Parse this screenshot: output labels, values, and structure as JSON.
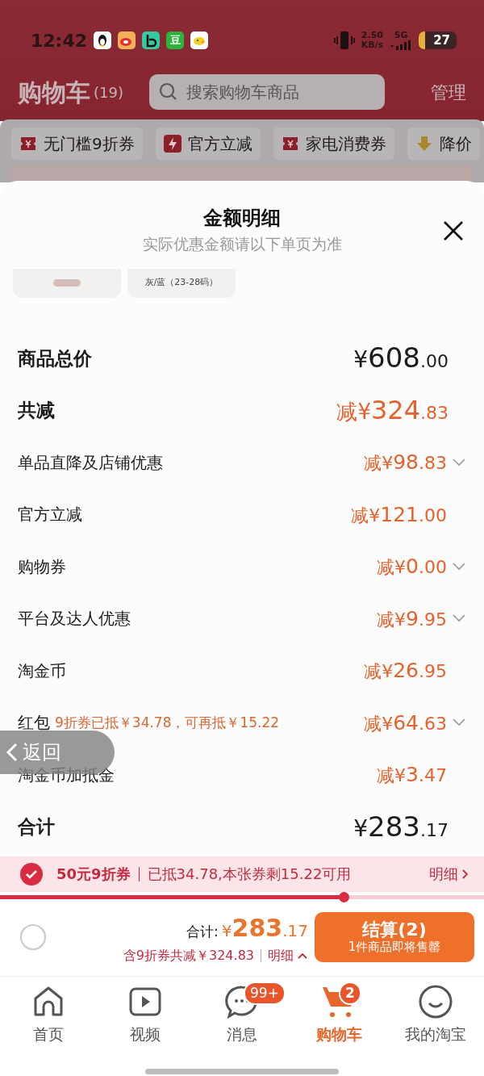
{
  "status_bar": {
    "time": "12:42",
    "app_icons": [
      {
        "kind": "penguin"
      },
      {
        "kind": "swirl"
      },
      {
        "kind": "letter-b"
      },
      {
        "kind": "text",
        "text": "豆"
      },
      {
        "kind": "chick"
      }
    ],
    "speed": "2.50",
    "speed_unit": "KB/s",
    "network": "5G",
    "battery": "27"
  },
  "header": {
    "title": "购物车",
    "count": "(19)",
    "search_placeholder": "搜索购物车商品",
    "manage": "管理"
  },
  "chips": [
    {
      "label": "无门槛9折券",
      "kind": "coupon"
    },
    {
      "label": "官方立减",
      "kind": "bolt"
    },
    {
      "label": "家电消费券",
      "kind": "coupon"
    },
    {
      "label": "降价",
      "kind": "arrow"
    }
  ],
  "sheet": {
    "title": "金额明细",
    "subtitle": "实际优惠金额请以下单页为准",
    "thumbnails": [
      {
        "kind": "badge"
      },
      {
        "kind": "caption",
        "caption": "灰/蓝（23-28码）"
      }
    ],
    "rows": [
      {
        "kind": "total",
        "label": "商品总价",
        "amount": "¥608.00"
      },
      {
        "kind": "discount-total",
        "label": "共减",
        "amount": "减¥324.83"
      },
      {
        "kind": "item",
        "label": "单品直降及店铺优惠",
        "amount": "减¥98.83",
        "expandable": true
      },
      {
        "kind": "item",
        "label": "官方立减",
        "amount": "减¥121.00",
        "expandable": false
      },
      {
        "kind": "item",
        "label": "购物券",
        "amount": "减¥0.00",
        "expandable": true
      },
      {
        "kind": "item",
        "label": "平台及达人优惠",
        "amount": "减¥9.95",
        "expandable": true
      },
      {
        "kind": "item",
        "label": "淘金币",
        "amount": "减¥26.95",
        "expandable": false
      },
      {
        "kind": "item",
        "label": "红包",
        "note": "9折券已抵￥34.78，可再抵￥15.22",
        "amount": "减¥64.63",
        "expandable": true
      },
      {
        "kind": "item",
        "label": "淘金币加抵金",
        "amount": "减¥3.47",
        "expandable": false
      },
      {
        "kind": "total",
        "label": "合计",
        "amount": "¥283.17"
      }
    ]
  },
  "coupon_bar": {
    "checked": true,
    "name": "50元9折券",
    "detail": "已抵34.78,本张券剩15.22可用",
    "link": "明细",
    "level": 0.71
  },
  "checkout": {
    "select_all_checked": false,
    "total_label": "合计:",
    "total": "¥283.17",
    "saving": "含9折券共减￥324.83",
    "detail_link": "明细",
    "button": "结算(2)",
    "button_note": "1件商品即将售罄"
  },
  "back_pill": {
    "label": "返回"
  },
  "tabs": [
    {
      "label": "首页",
      "kind": "home",
      "selected": false
    },
    {
      "label": "视频",
      "kind": "video",
      "selected": false
    },
    {
      "label": "消息",
      "kind": "chat",
      "selected": false,
      "badge": "99+"
    },
    {
      "label": "购物车",
      "kind": "cart",
      "selected": true,
      "badge": "2"
    },
    {
      "label": "我的淘宝",
      "kind": "face",
      "selected": false
    }
  ]
}
